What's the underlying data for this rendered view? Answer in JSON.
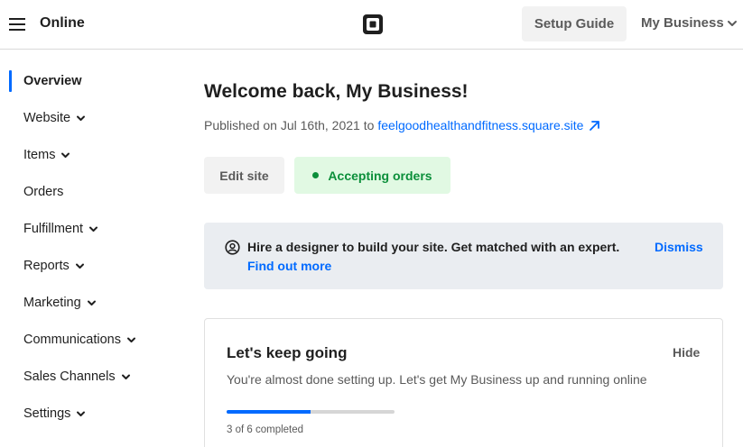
{
  "header": {
    "app_title": "Online",
    "logo_icon": "square-logo-icon",
    "setup_guide_label": "Setup Guide",
    "business_menu_label": "My Business"
  },
  "sidebar": {
    "items": [
      {
        "label": "Overview",
        "active": true,
        "has_chevron": false
      },
      {
        "label": "Website",
        "active": false,
        "has_chevron": true
      },
      {
        "label": "Items",
        "active": false,
        "has_chevron": true
      },
      {
        "label": "Orders",
        "active": false,
        "has_chevron": false
      },
      {
        "label": "Fulfillment",
        "active": false,
        "has_chevron": true
      },
      {
        "label": "Reports",
        "active": false,
        "has_chevron": true
      },
      {
        "label": "Marketing",
        "active": false,
        "has_chevron": true
      },
      {
        "label": "Communications",
        "active": false,
        "has_chevron": true
      },
      {
        "label": "Sales Channels",
        "active": false,
        "has_chevron": true
      },
      {
        "label": "Settings",
        "active": false,
        "has_chevron": true
      }
    ]
  },
  "main": {
    "welcome": "Welcome back, My Business!",
    "published_prefix": "Published on Jul 16th, 2021 to",
    "site_url": "feelgoodhealthandfitness.square.site",
    "edit_site_label": "Edit site",
    "accepting_orders_label": "Accepting orders",
    "banner": {
      "text": "Hire a designer to build your site. Get matched with an expert.",
      "link": "Find out more",
      "dismiss": "Dismiss"
    },
    "card": {
      "title": "Let's keep going",
      "hide": "Hide",
      "subtitle": "You're almost done setting up. Let's get My Business up and running online",
      "progress_completed": 3,
      "progress_total": 6,
      "progress_label": "3 of 6 completed"
    }
  },
  "colors": {
    "accent": "#006aff",
    "success": "#0b8f3a",
    "success_bg": "#e1f9e3",
    "banner_bg": "#eaedf1"
  }
}
